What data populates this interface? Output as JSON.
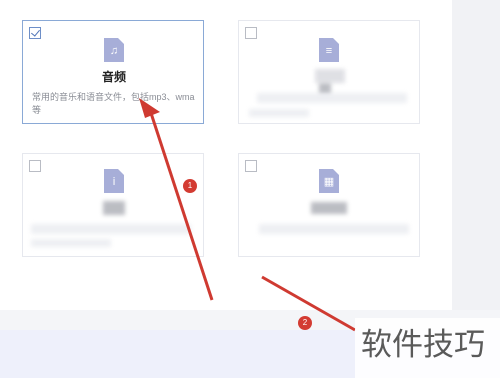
{
  "cards": [
    {
      "checked": true,
      "icon": "music-file-icon",
      "title": "音频",
      "description": "常用的音乐和语音文件，包括mp3、wma等"
    },
    {
      "checked": false,
      "icon": "text-file-icon",
      "title": "",
      "description": ""
    },
    {
      "checked": false,
      "icon": "info-file-icon",
      "title": "",
      "description": ""
    },
    {
      "checked": false,
      "icon": "grid-file-icon",
      "title": "",
      "description": ""
    }
  ],
  "annotations": {
    "badge_1": "1",
    "badge_2": "2",
    "arrow_color": "#cf3a31"
  },
  "watermark": "软件技巧",
  "colors": {
    "selected_border": "#8aa9d6",
    "file_icon": "#a7aed8",
    "badge": "#d33b32"
  }
}
